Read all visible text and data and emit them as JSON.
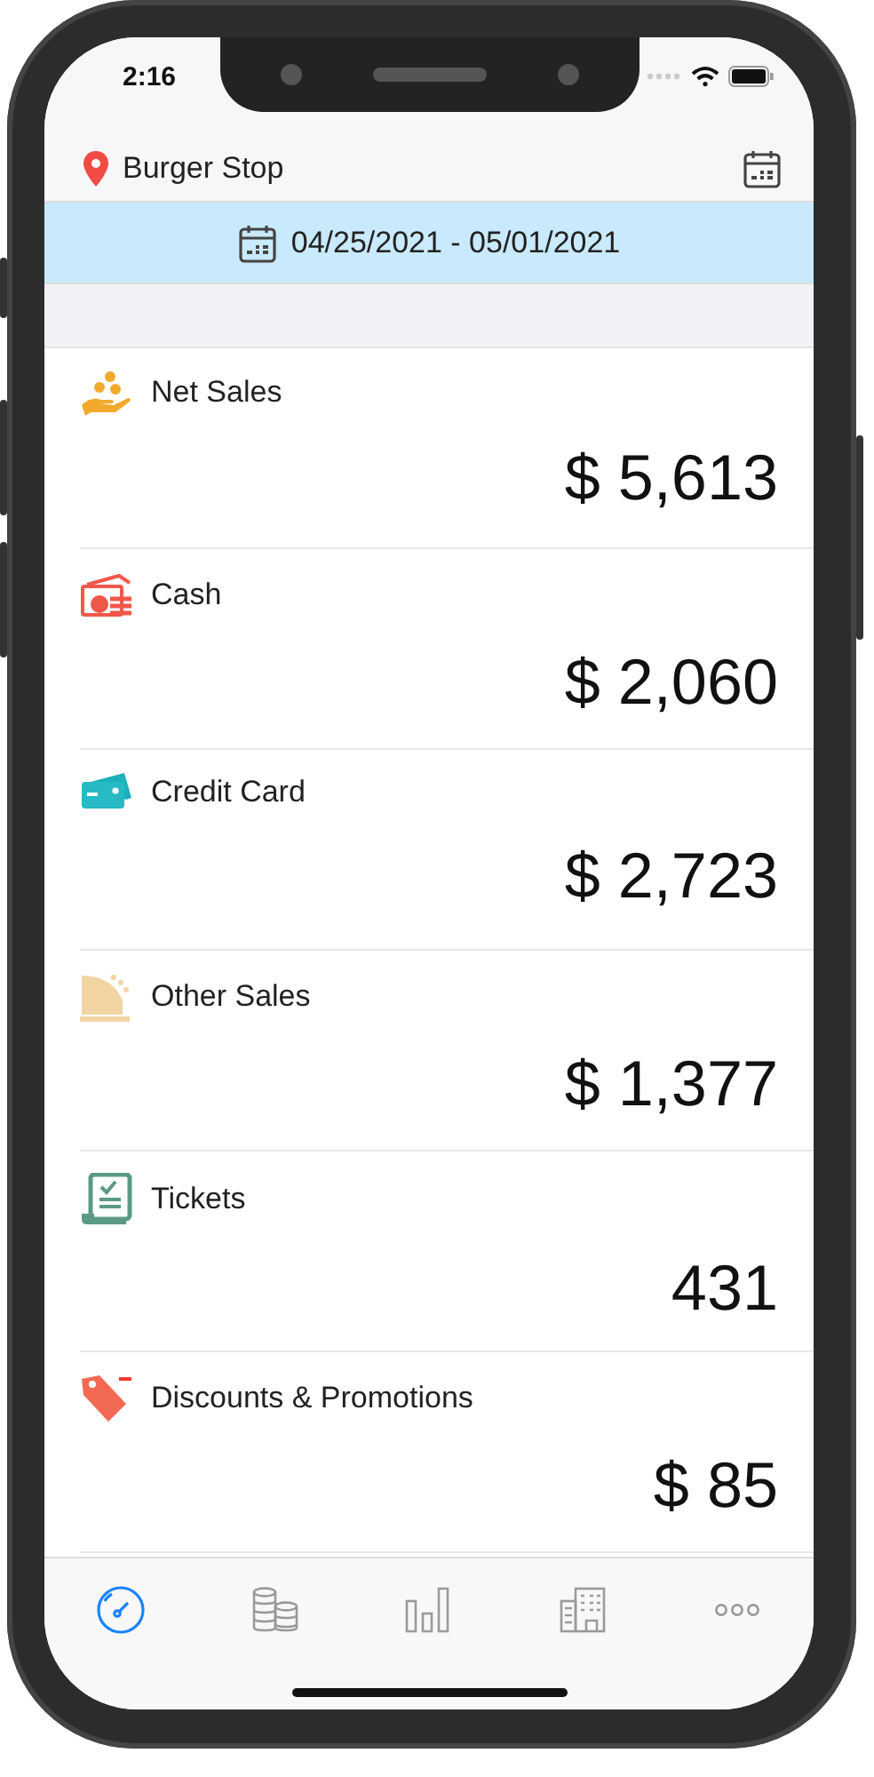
{
  "status_bar": {
    "time": "2:16"
  },
  "header": {
    "location": "Burger Stop"
  },
  "date_range": {
    "label": "04/25/2021 - 05/01/2021"
  },
  "metrics": [
    {
      "kind": "net_sales",
      "label": "Net Sales",
      "value": "$ 5,613"
    },
    {
      "kind": "cash",
      "label": "Cash",
      "value": "$ 2,060"
    },
    {
      "kind": "credit_card",
      "label": "Credit Card",
      "value": "$ 2,723"
    },
    {
      "kind": "other_sales",
      "label": "Other Sales",
      "value": "$ 1,377"
    },
    {
      "kind": "tickets",
      "label": "Tickets",
      "value": "431"
    },
    {
      "kind": "discounts",
      "label": "Discounts & Promotions",
      "value": "$ 85"
    }
  ],
  "tab_bar": [
    {
      "kind": "dashboard",
      "selected": true
    },
    {
      "kind": "coins",
      "selected": false
    },
    {
      "kind": "chart",
      "selected": false
    },
    {
      "kind": "building",
      "selected": false
    },
    {
      "kind": "more",
      "selected": false
    }
  ]
}
